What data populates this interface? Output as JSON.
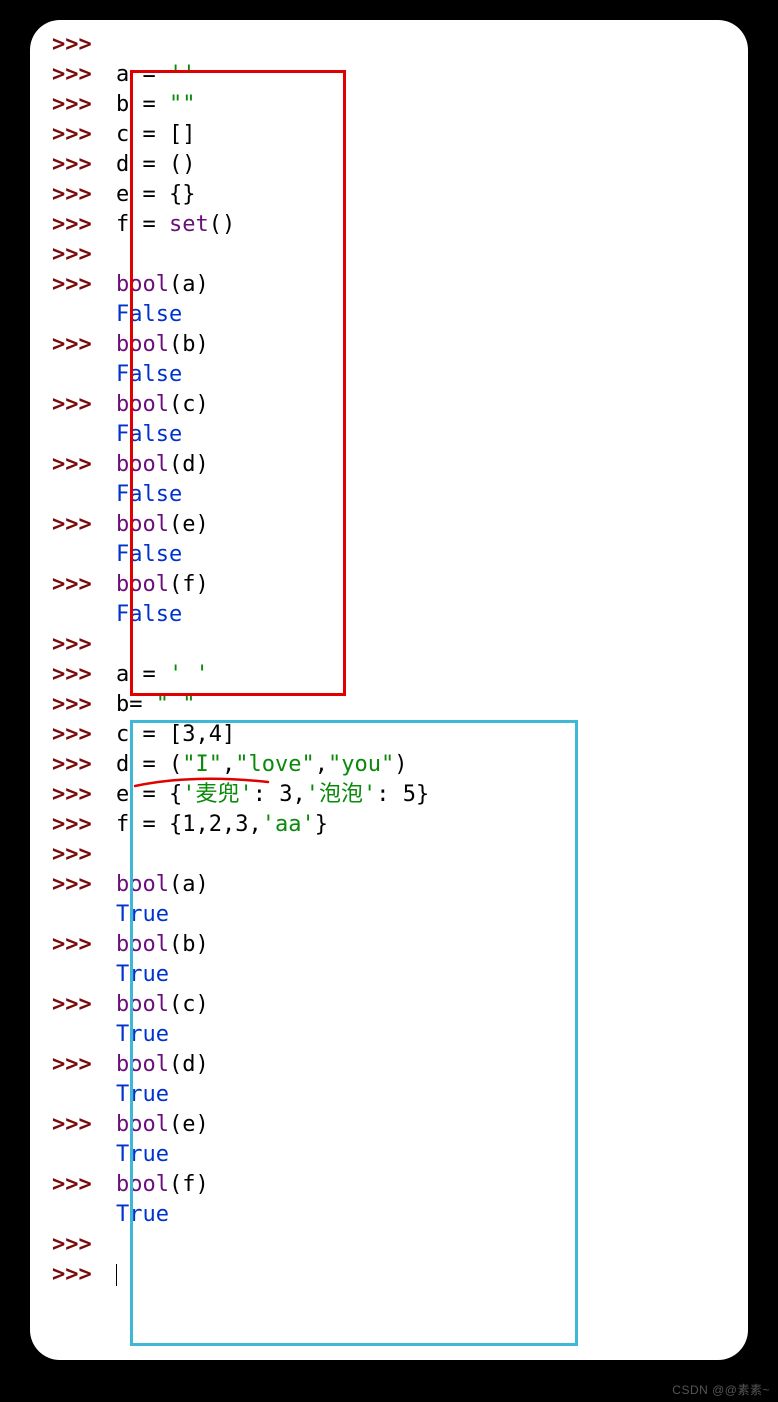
{
  "prompt": ">>>",
  "watermark": "CSDN @@素素~",
  "lines": [
    {
      "p": true,
      "segs": []
    },
    {
      "p": true,
      "segs": [
        {
          "t": "a = ",
          "c": "var"
        },
        {
          "t": "''",
          "c": "str"
        }
      ]
    },
    {
      "p": true,
      "segs": [
        {
          "t": "b = ",
          "c": "var"
        },
        {
          "t": "\"\"",
          "c": "str"
        }
      ]
    },
    {
      "p": true,
      "segs": [
        {
          "t": "c = []",
          "c": "var"
        }
      ]
    },
    {
      "p": true,
      "segs": [
        {
          "t": "d = ()",
          "c": "var"
        }
      ]
    },
    {
      "p": true,
      "segs": [
        {
          "t": "e = {}",
          "c": "var"
        }
      ]
    },
    {
      "p": true,
      "segs": [
        {
          "t": "f = ",
          "c": "var"
        },
        {
          "t": "set",
          "c": "fn"
        },
        {
          "t": "()",
          "c": "var"
        }
      ]
    },
    {
      "p": true,
      "segs": []
    },
    {
      "p": true,
      "segs": [
        {
          "t": "bool",
          "c": "fn"
        },
        {
          "t": "(a)",
          "c": "var"
        }
      ]
    },
    {
      "p": false,
      "segs": [
        {
          "t": "False",
          "c": "bool"
        }
      ]
    },
    {
      "p": true,
      "segs": [
        {
          "t": "bool",
          "c": "fn"
        },
        {
          "t": "(b)",
          "c": "var"
        }
      ]
    },
    {
      "p": false,
      "segs": [
        {
          "t": "False",
          "c": "bool"
        }
      ]
    },
    {
      "p": true,
      "segs": [
        {
          "t": "bool",
          "c": "fn"
        },
        {
          "t": "(c)",
          "c": "var"
        }
      ]
    },
    {
      "p": false,
      "segs": [
        {
          "t": "False",
          "c": "bool"
        }
      ]
    },
    {
      "p": true,
      "segs": [
        {
          "t": "bool",
          "c": "fn"
        },
        {
          "t": "(d)",
          "c": "var"
        }
      ]
    },
    {
      "p": false,
      "segs": [
        {
          "t": "False",
          "c": "bool"
        }
      ]
    },
    {
      "p": true,
      "segs": [
        {
          "t": "bool",
          "c": "fn"
        },
        {
          "t": "(e)",
          "c": "var"
        }
      ]
    },
    {
      "p": false,
      "segs": [
        {
          "t": "False",
          "c": "bool"
        }
      ]
    },
    {
      "p": true,
      "segs": [
        {
          "t": "bool",
          "c": "fn"
        },
        {
          "t": "(f)",
          "c": "var"
        }
      ]
    },
    {
      "p": false,
      "segs": [
        {
          "t": "False",
          "c": "bool"
        }
      ]
    },
    {
      "p": true,
      "segs": []
    },
    {
      "p": true,
      "segs": [
        {
          "t": "a = ",
          "c": "var"
        },
        {
          "t": "' '",
          "c": "str"
        }
      ]
    },
    {
      "p": true,
      "segs": [
        {
          "t": "b= ",
          "c": "var"
        },
        {
          "t": "\" \"",
          "c": "str"
        }
      ]
    },
    {
      "p": true,
      "segs": [
        {
          "t": "c = [",
          "c": "var"
        },
        {
          "t": "3",
          "c": "num"
        },
        {
          "t": ",",
          "c": "var"
        },
        {
          "t": "4",
          "c": "num"
        },
        {
          "t": "]",
          "c": "var"
        }
      ]
    },
    {
      "p": true,
      "segs": [
        {
          "t": "d = (",
          "c": "var"
        },
        {
          "t": "\"I\"",
          "c": "str"
        },
        {
          "t": ",",
          "c": "var"
        },
        {
          "t": "\"love\"",
          "c": "str"
        },
        {
          "t": ",",
          "c": "var"
        },
        {
          "t": "\"you\"",
          "c": "str"
        },
        {
          "t": ")",
          "c": "var"
        }
      ]
    },
    {
      "p": true,
      "segs": [
        {
          "t": "e = {",
          "c": "var"
        },
        {
          "t": "'麦兜'",
          "c": "str"
        },
        {
          "t": ": ",
          "c": "var"
        },
        {
          "t": "3",
          "c": "num"
        },
        {
          "t": ",",
          "c": "var"
        },
        {
          "t": "'泡泡'",
          "c": "str"
        },
        {
          "t": ": ",
          "c": "var"
        },
        {
          "t": "5",
          "c": "num"
        },
        {
          "t": "}",
          "c": "var"
        }
      ]
    },
    {
      "p": true,
      "segs": [
        {
          "t": "f = {",
          "c": "var"
        },
        {
          "t": "1",
          "c": "num"
        },
        {
          "t": ",",
          "c": "var"
        },
        {
          "t": "2",
          "c": "num"
        },
        {
          "t": ",",
          "c": "var"
        },
        {
          "t": "3",
          "c": "num"
        },
        {
          "t": ",",
          "c": "var"
        },
        {
          "t": "'aa'",
          "c": "str"
        },
        {
          "t": "}",
          "c": "var"
        }
      ]
    },
    {
      "p": true,
      "segs": []
    },
    {
      "p": true,
      "segs": [
        {
          "t": "bool",
          "c": "fn"
        },
        {
          "t": "(a)",
          "c": "var"
        }
      ]
    },
    {
      "p": false,
      "segs": [
        {
          "t": "True",
          "c": "bool"
        }
      ]
    },
    {
      "p": true,
      "segs": [
        {
          "t": "bool",
          "c": "fn"
        },
        {
          "t": "(b)",
          "c": "var"
        }
      ]
    },
    {
      "p": false,
      "segs": [
        {
          "t": "True",
          "c": "bool"
        }
      ]
    },
    {
      "p": true,
      "segs": [
        {
          "t": "bool",
          "c": "fn"
        },
        {
          "t": "(c)",
          "c": "var"
        }
      ]
    },
    {
      "p": false,
      "segs": [
        {
          "t": "True",
          "c": "bool"
        }
      ]
    },
    {
      "p": true,
      "segs": [
        {
          "t": "bool",
          "c": "fn"
        },
        {
          "t": "(d)",
          "c": "var"
        }
      ]
    },
    {
      "p": false,
      "segs": [
        {
          "t": "True",
          "c": "bool"
        }
      ]
    },
    {
      "p": true,
      "segs": [
        {
          "t": "bool",
          "c": "fn"
        },
        {
          "t": "(e)",
          "c": "var"
        }
      ]
    },
    {
      "p": false,
      "segs": [
        {
          "t": "True",
          "c": "bool"
        }
      ]
    },
    {
      "p": true,
      "segs": [
        {
          "t": "bool",
          "c": "fn"
        },
        {
          "t": "(f)",
          "c": "var"
        }
      ]
    },
    {
      "p": false,
      "segs": [
        {
          "t": "True",
          "c": "bool"
        }
      ]
    },
    {
      "p": true,
      "segs": []
    },
    {
      "p": true,
      "segs": [],
      "cursor": true
    }
  ]
}
